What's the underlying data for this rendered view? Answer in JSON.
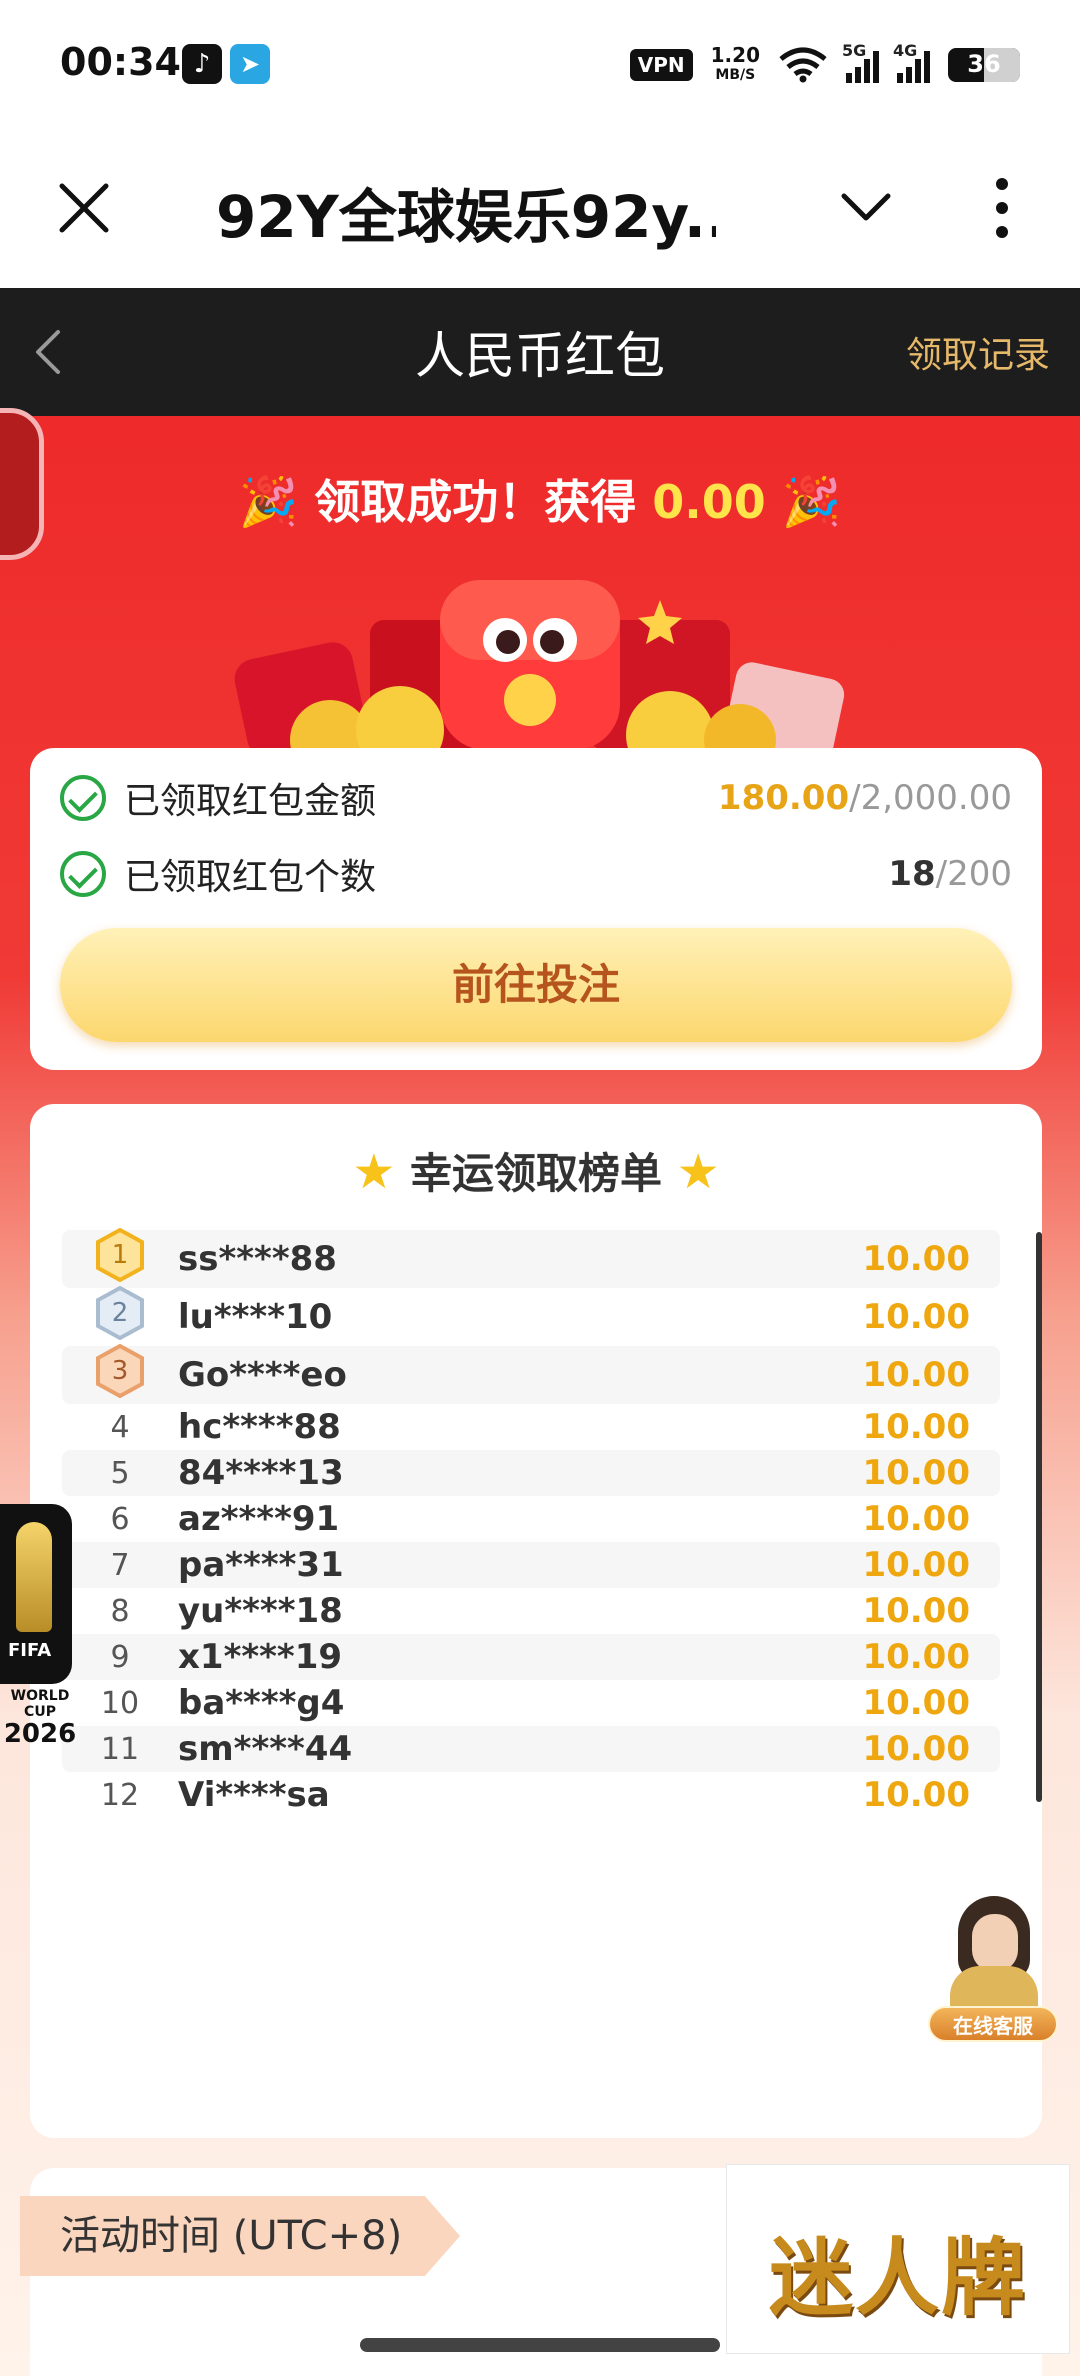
{
  "status_bar": {
    "time": "00:34",
    "vpn": "VPN",
    "speed_value": "1.20",
    "speed_unit": "MB/S",
    "net1": "5G",
    "net2": "4G",
    "battery": "36"
  },
  "browser": {
    "title": "92Y全球娱乐92y..."
  },
  "app_header": {
    "title": "人民币红包",
    "record_link": "领取记录"
  },
  "hero": {
    "success_prefix": "领取成功！获得",
    "success_amount": "0.00"
  },
  "summary": {
    "amount_label": "已领取红包金额",
    "amount_claimed": "180.00",
    "amount_total": "/2,000.00",
    "count_label": "已领取红包个数",
    "count_claimed": "18",
    "count_total": "/200",
    "bet_button": "前往投注"
  },
  "leaderboard": {
    "title": "幸运领取榜单",
    "rows": [
      {
        "rank": "1",
        "name": "ss****88",
        "amount": "10.00"
      },
      {
        "rank": "2",
        "name": "lu****10",
        "amount": "10.00"
      },
      {
        "rank": "3",
        "name": "Go****eo",
        "amount": "10.00"
      },
      {
        "rank": "4",
        "name": "hc****88",
        "amount": "10.00"
      },
      {
        "rank": "5",
        "name": "84****13",
        "amount": "10.00"
      },
      {
        "rank": "6",
        "name": "az****91",
        "amount": "10.00"
      },
      {
        "rank": "7",
        "name": "pa****31",
        "amount": "10.00"
      },
      {
        "rank": "8",
        "name": "yu****18",
        "amount": "10.00"
      },
      {
        "rank": "9",
        "name": "x1****19",
        "amount": "10.00"
      },
      {
        "rank": "10",
        "name": "ba****g4",
        "amount": "10.00"
      },
      {
        "rank": "11",
        "name": "sm****44",
        "amount": "10.00"
      },
      {
        "rank": "12",
        "name": "Vi****sa",
        "amount": "10.00"
      }
    ]
  },
  "fifa": {
    "logo_text": "FIFA",
    "caption": "WORLD CUP",
    "year": "2026"
  },
  "customer_service": {
    "label": "在线客服"
  },
  "activity": {
    "time_label": "活动时间 (UTC+8)"
  },
  "brand": {
    "text": "迷人牌"
  },
  "colors": {
    "red": "#ee2a2a",
    "gold": "#efa70f",
    "header_bg": "#1d1d1d"
  }
}
